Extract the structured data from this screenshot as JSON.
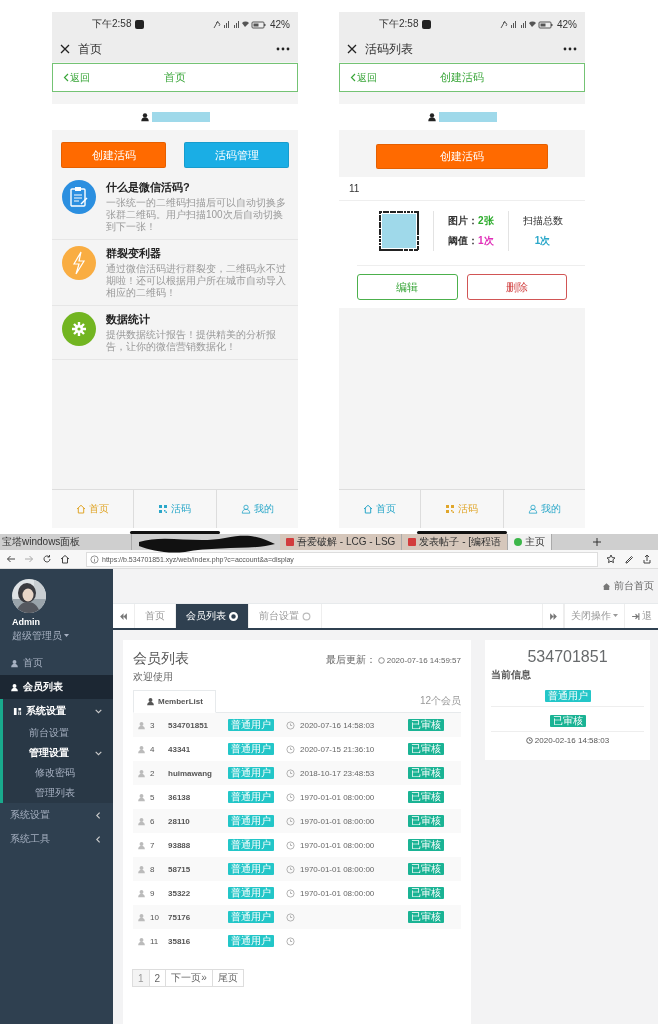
{
  "home_phone": {
    "status_time": "下午2:58",
    "battery": "42%",
    "window_title": "首页",
    "back": "返回",
    "nav_title": "首页",
    "buttons": [
      {
        "label": "创建活码",
        "color": "#ff6a00"
      },
      {
        "label": "活码管理",
        "color": "#1aaee5"
      }
    ],
    "features": [
      {
        "kind": "clipboard",
        "color": "#2b8fe0",
        "title": "什么是微信活码?",
        "text": "一张统一的二维码扫描后可以自动切换多张群二维码。用户扫描100次后自动切换到下一张！"
      },
      {
        "kind": "bolt",
        "color": "#f9ad42",
        "title": "群裂变利器",
        "text": "通过微信活码进行群裂变，二维码永不过期啦！还可以根据用户所在城市自动导入相应的二维码！"
      },
      {
        "kind": "gear",
        "color": "#72b521",
        "title": "数据统计",
        "text": "提供数据统计报告！提供精美的分析报告，让你的微信营销数据化！"
      }
    ],
    "tabbar": [
      {
        "kind": "home",
        "label": "首页",
        "selected": true
      },
      {
        "kind": "qr",
        "label": "活码",
        "selected": false
      },
      {
        "kind": "user",
        "label": "我的",
        "selected": false
      }
    ]
  },
  "list_phone": {
    "status_time": "下午2:58",
    "battery": "42%",
    "window_title": "活码列表",
    "back": "返回",
    "nav_title": "创建活码",
    "create_button": "创建活码",
    "code": {
      "name": "11",
      "images_label": "图片：",
      "images": "2张",
      "threshold_label": "阈值：",
      "threshold": "1次",
      "scans_label": "扫描总数",
      "scans": "1次"
    },
    "edit_button": "编辑",
    "delete_button": "删除",
    "tabbar": [
      {
        "kind": "home",
        "label": "首页",
        "selected": false
      },
      {
        "kind": "qr",
        "label": "活码",
        "selected": true
      },
      {
        "kind": "user",
        "label": "我的",
        "selected": false
      }
    ]
  },
  "browser": {
    "tabs": [
      {
        "title": "宝塔windows面板",
        "selected": false
      },
      {
        "title": "吾爱破解 - LCG - LSG",
        "selected": false
      },
      {
        "title": "发表帖子 - [编程语",
        "selected": false
      },
      {
        "title": "主页",
        "selected": true
      }
    ],
    "url": "https://b.534701851.xyz/web/index.php?c=account&a=display"
  },
  "admin": {
    "user": "Admin",
    "role": "超级管理员",
    "nav": [
      {
        "kind": "user",
        "label": "首页",
        "selected": false
      },
      {
        "kind": "user",
        "label": "会员列表",
        "selected": true
      },
      {
        "kind": "columns",
        "label": "系统设置",
        "selected": false,
        "expanded": true,
        "children": [
          {
            "label": "前台设置",
            "selected": false
          },
          {
            "label": "管理设置",
            "selected": false,
            "expanded": true,
            "children": [
              {
                "label": "修改密码",
                "selected": false
              },
              {
                "label": "管理列表",
                "selected": false
              }
            ]
          }
        ]
      },
      {
        "label": "系统设置",
        "selected": false,
        "expanded": false
      },
      {
        "label": "系统工具",
        "selected": false,
        "expanded": false
      }
    ],
    "header_link": "前台首页",
    "page_tabs": [
      {
        "label": "首页",
        "selected": false
      },
      {
        "label": "会员列表",
        "selected": true
      },
      {
        "label": "前台设置",
        "selected": false
      }
    ],
    "close_menu": "关闭操作",
    "logout": "退",
    "list": {
      "title": "会员列表",
      "subtitle": "欢迎使用",
      "updated_label": "最后更新：",
      "updated": "2020-07-16 14:59:57",
      "tab": "MemberList",
      "count": "12个会员",
      "rows": [
        {
          "id": "3",
          "name": "534701851",
          "type": "普通用户",
          "date": "2020-07-16 14:58:03",
          "status": "已审核"
        },
        {
          "id": "4",
          "name": "43341",
          "type": "普通用户",
          "date": "2020-07-15 21:36:10",
          "status": "已审核"
        },
        {
          "id": "2",
          "name": "huimawang",
          "type": "普通用户",
          "date": "2018-10-17 23:48:53",
          "status": "已审核"
        },
        {
          "id": "5",
          "name": "36138",
          "type": "普通用户",
          "date": "1970-01-01 08:00:00",
          "status": "已审核"
        },
        {
          "id": "6",
          "name": "28110",
          "type": "普通用户",
          "date": "1970-01-01 08:00:00",
          "status": "已审核"
        },
        {
          "id": "7",
          "name": "93888",
          "type": "普通用户",
          "date": "1970-01-01 08:00:00",
          "status": "已审核"
        },
        {
          "id": "8",
          "name": "58715",
          "type": "普通用户",
          "date": "1970-01-01 08:00:00",
          "status": "已审核"
        },
        {
          "id": "9",
          "name": "35322",
          "type": "普通用户",
          "date": "1970-01-01 08:00:00",
          "status": "已审核"
        },
        {
          "id": "10",
          "name": "75176",
          "type": "普通用户",
          "status": "已审核"
        },
        {
          "id": "11",
          "name": "35816",
          "type": "普通用户"
        }
      ],
      "pages": [
        {
          "label": "1",
          "selected": true
        },
        {
          "label": "2",
          "selected": false
        },
        {
          "label": "下一页»",
          "selected": false
        },
        {
          "label": "尾页",
          "selected": false
        }
      ]
    },
    "detail": {
      "name": "534701851",
      "section": "当前信息",
      "type": "普通用户",
      "status": "已审核",
      "date": "2020-02-16 14:58:03"
    }
  }
}
